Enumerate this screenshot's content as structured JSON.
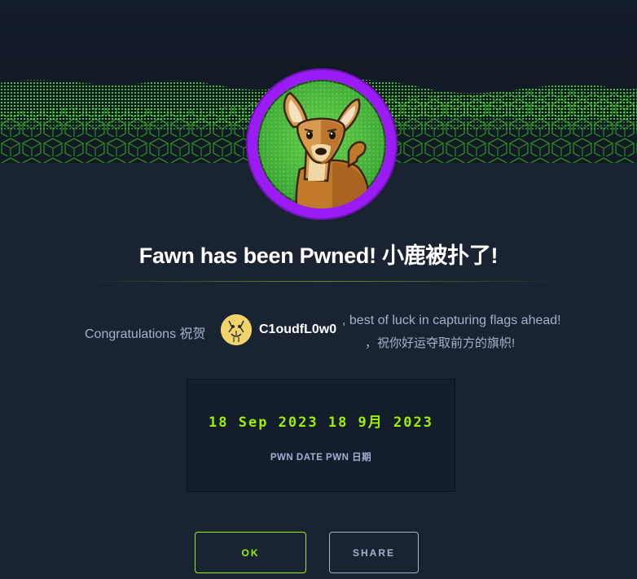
{
  "modal": {
    "title": "Fawn has been Pwned! 小鹿被扑了!",
    "congrats_prefix": "Congratulations 祝贺",
    "username": "C1oudfL0w0",
    "luck_en": ", best of luck in capturing flags ahead!",
    "luck_zh": "，祝你好运夺取前方的旗帜!",
    "pwn_date": "18 Sep 2023 18 9月 2023",
    "pwn_date_label": "PWN DATE PWN 日期",
    "ok_label": "OK",
    "share_label": "SHARE"
  },
  "icons": {
    "machine_avatar": "fawn-deer-icon",
    "user_avatar": "user-avatar-icon",
    "banner": "green-cubes-wave-banner"
  },
  "colors": {
    "background": "#1a2332",
    "accent_green": "#9fef00",
    "ring_purple": "#9b1bf5",
    "muted_text": "#a4b1cd"
  }
}
